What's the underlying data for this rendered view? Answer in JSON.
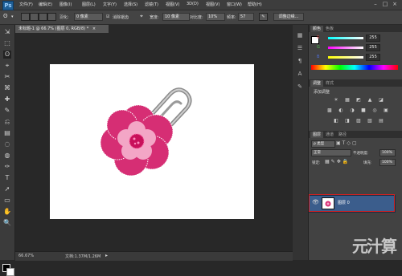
{
  "menubar": {
    "logo": "Ps",
    "items": [
      "文件(F)",
      "编辑(E)",
      "图像(I)",
      "图层(L)",
      "文字(Y)",
      "选择(S)",
      "滤镜(T)",
      "视图(V)",
      "3D(D)",
      "视图(V)",
      "窗口(W)",
      "帮助(H)"
    ],
    "minimize": "–",
    "maximize": "□",
    "close": "×"
  },
  "options": {
    "feather_label": "羽化:",
    "feather_value": "0 像素",
    "antialias_label": "消除锯齿",
    "width_label": "宽度:",
    "width_value": "10 像素",
    "contrast_label": "对比度:",
    "contrast_value": "10%",
    "frequency_label": "频率:",
    "frequency_value": "57",
    "refine_edge": "调整边缘..."
  },
  "document": {
    "tab_title": "未标题-1 @ 66.7% (图层 0, RGB/8) *",
    "tab_close": "×"
  },
  "status": {
    "zoom": "66.67%",
    "doc_size": "文档:1.37M/1.26M"
  },
  "color_panel": {
    "tabs": [
      "颜色",
      "色板"
    ],
    "sliders": [
      {
        "label": "R",
        "value": "255",
        "color": "#e04040"
      },
      {
        "label": "G",
        "value": "255",
        "color": "#40c040"
      },
      {
        "label": "B",
        "value": "255",
        "color": "#4060e0"
      }
    ]
  },
  "adjustments_panel": {
    "tabs": [
      "调整",
      "样式"
    ],
    "heading": "添加调整",
    "row1": [
      "☀",
      "▦",
      "◩",
      "▲",
      "◪"
    ],
    "row2": [
      "▩",
      "◐",
      "◑",
      "■",
      "◎",
      "▣"
    ],
    "row3": [
      "◧",
      "◨",
      "▨",
      "▧",
      "▤"
    ]
  },
  "layers_panel": {
    "tabs": [
      "图层",
      "通道",
      "路径"
    ],
    "kind_filter": "ρ 类型",
    "blend_mode": "正常",
    "opacity_label": "不透明度:",
    "opacity_value": "100%",
    "lock_label": "锁定:",
    "fill_label": "填充:",
    "fill_value": "100%",
    "layer_name": "图层 0",
    "eye": "👁"
  },
  "tools": [
    "⇲",
    "⬚",
    "ʘ",
    "⌖",
    "✂",
    "⌘",
    "✚",
    "✎",
    "⎌",
    "▤",
    "◌",
    "◍",
    "✑",
    "T",
    "➚",
    "▭",
    "✋",
    "🔍"
  ],
  "watermark": "元汁算"
}
